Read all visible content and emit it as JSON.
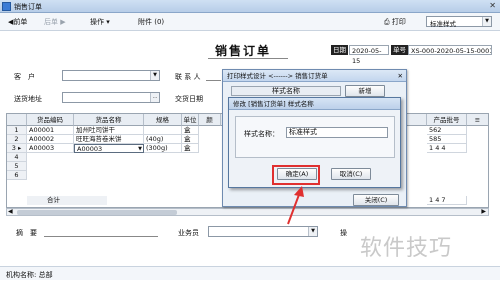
{
  "window": {
    "title": "销售订单"
  },
  "toolbar": {
    "prev": "◀前单",
    "next": "后单 ▶",
    "ops": "操作 ▾",
    "attach": "附件 (0)",
    "print": "打印",
    "style_value": "标准样式"
  },
  "doc": {
    "title": "销售订单",
    "date_label": "日期",
    "date_value": "2020-05-15",
    "no_label": "单号",
    "no_value": "XS-000-2020-05-15-0001"
  },
  "form": {
    "customer_label": "客　户",
    "contact_label": "联 系 人",
    "address_label": "送货地址",
    "deliver_label": "交货日期",
    "memo_label": "摘　要",
    "salesman_label": "业务员",
    "op_label": "操"
  },
  "grid": {
    "headers": [
      "",
      "货品编码",
      "货品名称",
      "规格",
      "单位",
      "颜"
    ],
    "right_header": "产品批号",
    "rows": [
      {
        "no": "1",
        "code": "A00001",
        "name": "加州吐司饼干",
        "spec": "",
        "unit": "盒",
        "tail": "562"
      },
      {
        "no": "2",
        "code": "A00002",
        "name": "旺旺海苔卷米饼",
        "spec": "(40g)",
        "unit": "盒",
        "tail": "585"
      },
      {
        "no": "3",
        "code": "A00003",
        "name": "A00003",
        "spec": "(300g)",
        "unit": "盒",
        "tail": "1 4 4"
      }
    ],
    "more_rows": [
      "4",
      "5",
      "6"
    ],
    "total_label": "合计",
    "total_tail": "1 4 7"
  },
  "dialog_style_design": {
    "title": "打印样式设计 <------> 销售订货单",
    "col_header": "样式名称",
    "tab_label": "新增",
    "close_button": "关闭(C)"
  },
  "dialog_edit": {
    "title": "修改 [销售订货单] 样式名称",
    "field_label": "样式名称：",
    "field_value": "标准样式",
    "ok_button": "确定(A)",
    "cancel_button": "取消(C)"
  },
  "status": {
    "text": "机构名称: 总部"
  },
  "watermark": "软件技巧",
  "colors": {
    "highlight": "#e03030",
    "caption": "#c3d6ee"
  }
}
